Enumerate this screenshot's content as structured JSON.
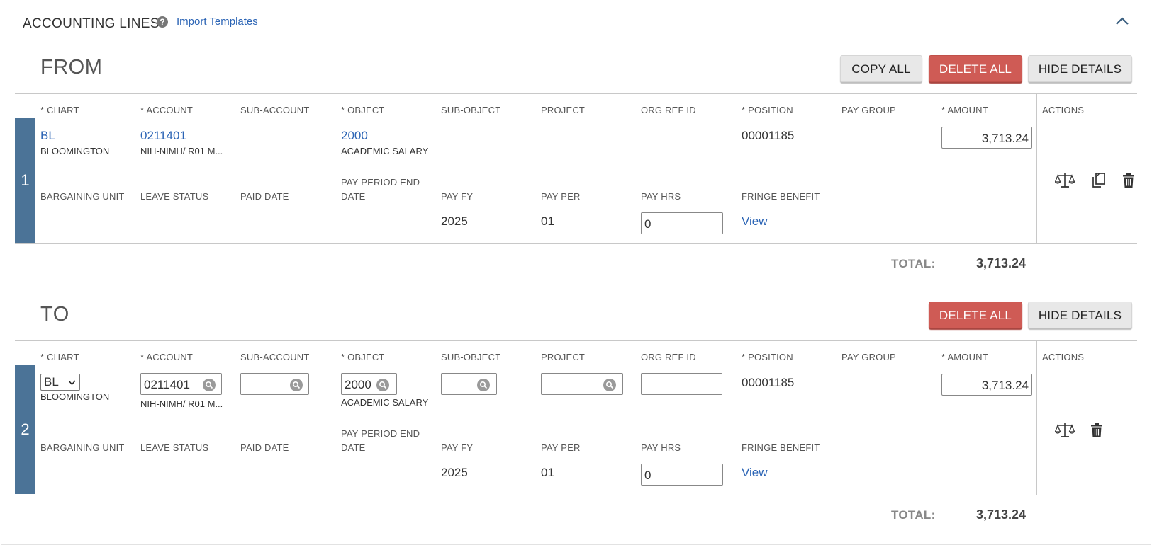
{
  "header": {
    "title": "ACCOUNTING LINES",
    "help_glyph": "?",
    "import_label": "Import Templates"
  },
  "from": {
    "title": "FROM",
    "buttons": {
      "copy_all": "COPY ALL",
      "delete_all": "DELETE ALL",
      "hide_details": "HIDE DETAILS"
    },
    "columns": [
      "* CHART",
      "* ACCOUNT",
      "SUB-ACCOUNT",
      "* OBJECT",
      "SUB-OBJECT",
      "PROJECT",
      "ORG REF ID",
      "* POSITION",
      "PAY GROUP",
      "* AMOUNT",
      "ACTIONS"
    ],
    "detail_columns": [
      "BARGAINING UNIT",
      "LEAVE STATUS",
      "PAID DATE",
      "PAY PERIOD END",
      "DATE",
      "PAY FY",
      "PAY PER",
      "PAY HRS",
      "FRINGE BENEFIT"
    ],
    "line": {
      "number": "1",
      "chart": "BL",
      "chart_name": "BLOOMINGTON",
      "account": "0211401",
      "account_name": "NIH-NIMH/ R01 M...",
      "object": "2000",
      "object_name": "ACADEMIC SALARY",
      "position": "00001185",
      "amount": "3,713.24",
      "pay_fy": "2025",
      "pay_per": "01",
      "pay_hrs": "0",
      "fringe_link": "View"
    },
    "total_label": "TOTAL:",
    "total_value": "3,713.24"
  },
  "to": {
    "title": "TO",
    "buttons": {
      "delete_all": "DELETE ALL",
      "hide_details": "HIDE DETAILS"
    },
    "columns": [
      "* CHART",
      "* ACCOUNT",
      "SUB-ACCOUNT",
      "* OBJECT",
      "SUB-OBJECT",
      "PROJECT",
      "ORG REF ID",
      "* POSITION",
      "PAY GROUP",
      "* AMOUNT",
      "ACTIONS"
    ],
    "detail_columns": [
      "BARGAINING UNIT",
      "LEAVE STATUS",
      "PAID DATE",
      "PAY PERIOD END",
      "DATE",
      "PAY FY",
      "PAY PER",
      "PAY HRS",
      "FRINGE BENEFIT"
    ],
    "line": {
      "number": "2",
      "chart": "BL",
      "chart_name": "BLOOMINGTON",
      "account": "0211401",
      "account_name": "NIH-NIMH/ R01 M...",
      "sub_account": "",
      "object": "2000",
      "object_name": "ACADEMIC SALARY",
      "sub_object": "",
      "project": "",
      "org_ref_id": "",
      "position": "00001185",
      "amount": "3,713.24",
      "pay_fy": "2025",
      "pay_per": "01",
      "pay_hrs": "0",
      "fringe_link": "View"
    },
    "total_label": "TOTAL:",
    "total_value": "3,713.24"
  },
  "icons": {
    "collapse": "chevron-up-icon",
    "help": "question-circle-icon",
    "lookup": "magnifier-icon",
    "balance": "balance-scale-icon",
    "copy": "copy-icon",
    "delete": "trash-icon"
  },
  "colors": {
    "row_bar": "#4b7397",
    "danger": "#cf5b55",
    "link": "#2b64b5"
  }
}
